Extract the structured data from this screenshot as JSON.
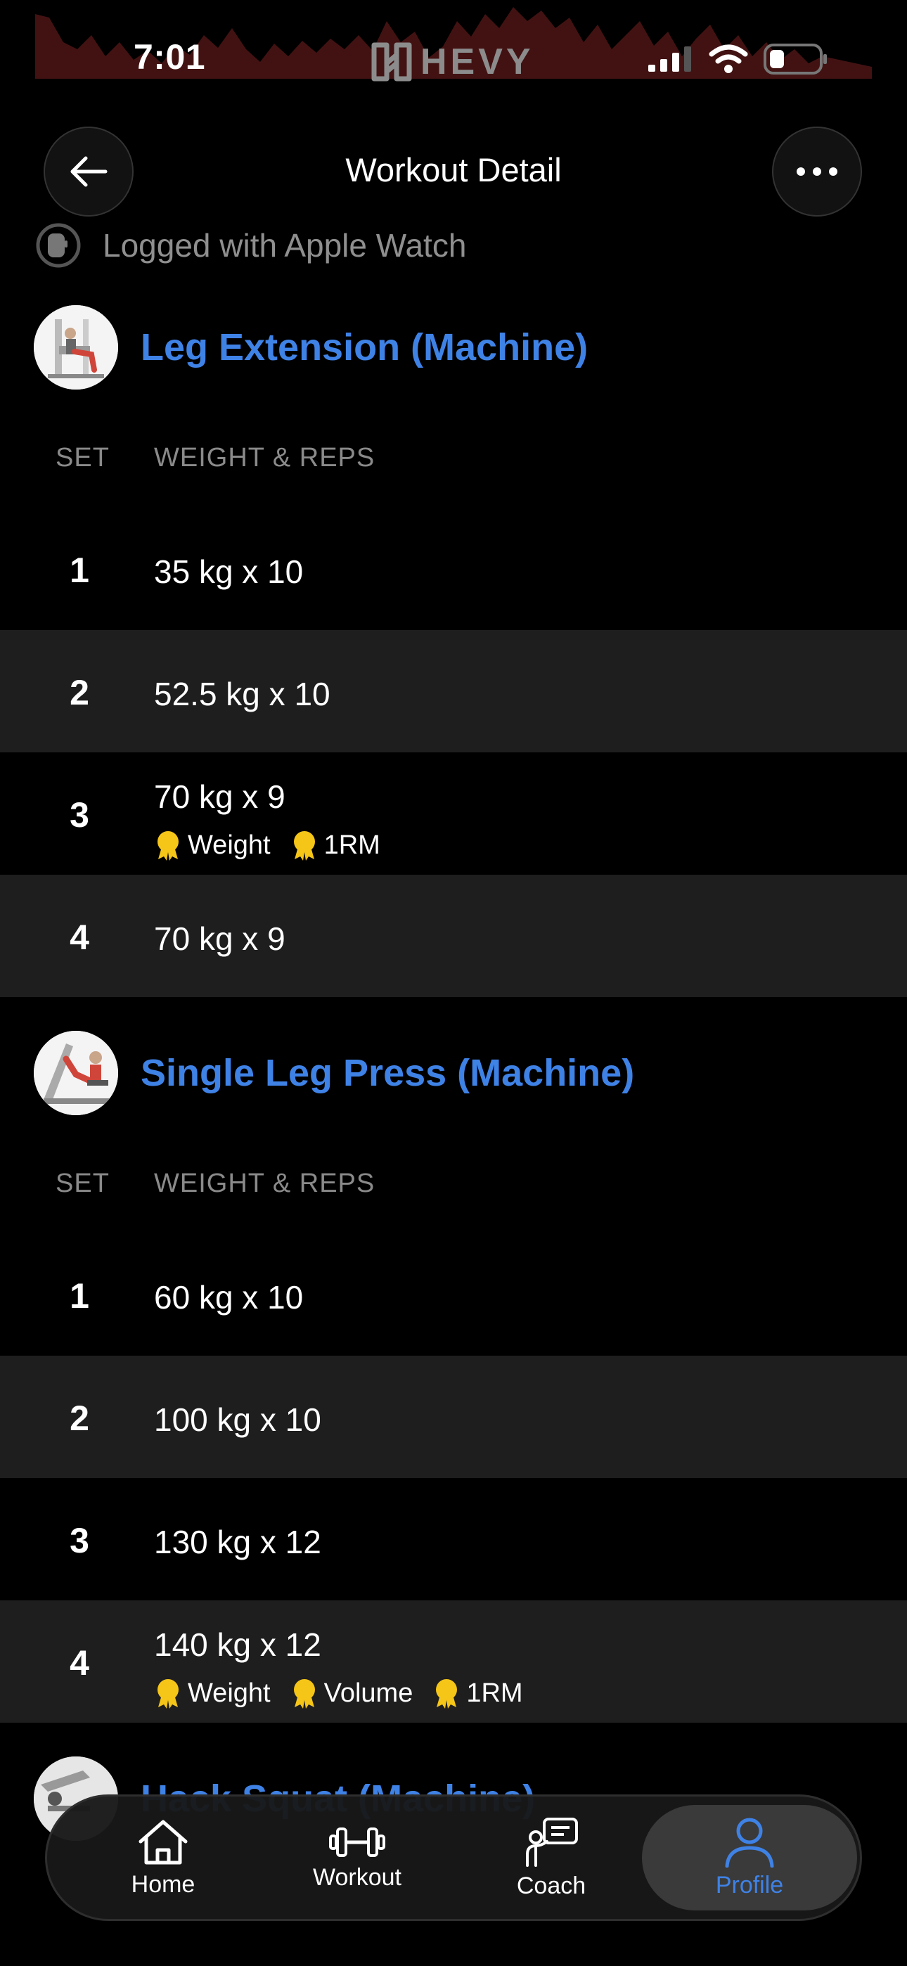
{
  "status_bar": {
    "time": "7:01",
    "app_logo": "HEVY"
  },
  "header": {
    "title": "Workout Detail",
    "back_icon": "arrow-left-icon",
    "more_icon": "ellipsis-icon"
  },
  "watch_note": {
    "text": "Logged with Apple Watch",
    "icon": "apple-watch-icon"
  },
  "exercises": [
    {
      "title": "Leg Extension (Machine)",
      "col_set": "SET",
      "col_weight": "WEIGHT & REPS",
      "sets": [
        {
          "num": "1",
          "value": "35 kg x 10",
          "badges": []
        },
        {
          "num": "2",
          "value": "52.5 kg x 10",
          "badges": []
        },
        {
          "num": "3",
          "value": "70 kg x 9",
          "badges": [
            "Weight",
            "1RM"
          ]
        },
        {
          "num": "4",
          "value": "70 kg x 9",
          "badges": []
        }
      ]
    },
    {
      "title": "Single Leg Press (Machine)",
      "col_set": "SET",
      "col_weight": "WEIGHT & REPS",
      "sets": [
        {
          "num": "1",
          "value": "60 kg x 10",
          "badges": []
        },
        {
          "num": "2",
          "value": "100 kg x 10",
          "badges": []
        },
        {
          "num": "3",
          "value": "130 kg x 12",
          "badges": []
        },
        {
          "num": "4",
          "value": "140 kg x 12",
          "badges": [
            "Weight",
            "Volume",
            "1RM"
          ]
        }
      ]
    },
    {
      "title": "Hack Squat (Machine)"
    }
  ],
  "tab_bar": {
    "tabs": [
      {
        "label": "Home",
        "icon": "home-icon",
        "active": false
      },
      {
        "label": "Workout",
        "icon": "dumbbell-icon",
        "active": false
      },
      {
        "label": "Coach",
        "icon": "coach-icon",
        "active": false
      },
      {
        "label": "Profile",
        "icon": "profile-icon",
        "active": true
      }
    ]
  },
  "colors": {
    "accent": "#3f82e6",
    "medal": "#f5c518",
    "alt_row": "#1e1e1e",
    "background": "#000000"
  }
}
